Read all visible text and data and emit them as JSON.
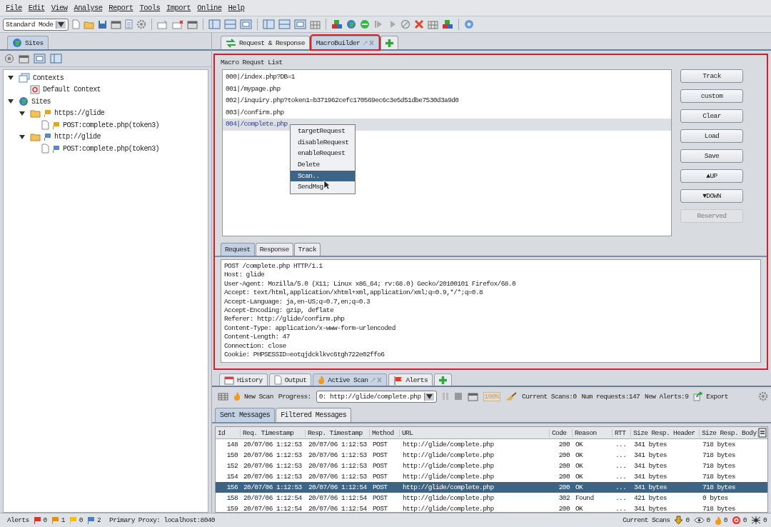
{
  "menu": [
    {
      "label": "File"
    },
    {
      "label": "Edit"
    },
    {
      "label": "View"
    },
    {
      "label": "Analyse"
    },
    {
      "label": "Report"
    },
    {
      "label": "Tools"
    },
    {
      "label": "Import"
    },
    {
      "label": "Online"
    },
    {
      "label": "Help"
    }
  ],
  "mode_select": {
    "value": "Standard Mode"
  },
  "left_tabs": [
    {
      "label": "Sites",
      "selected": true
    }
  ],
  "tree": [
    {
      "label": "Contexts",
      "kind": "contexts",
      "expanded": true,
      "children": [
        {
          "label": "Default Context",
          "kind": "context"
        }
      ]
    },
    {
      "label": "Sites",
      "kind": "globe",
      "expanded": true,
      "children": [
        {
          "label": "https://glide",
          "kind": "folder",
          "color": "#e8a317",
          "expanded": true,
          "children": [
            {
              "label": "POST:complete.php(token3)",
              "kind": "file",
              "color": "#e8a317"
            }
          ]
        },
        {
          "label": "http://glide",
          "kind": "folder",
          "color": "#5b87c5",
          "expanded": true,
          "children": [
            {
              "label": "POST:complete.php(token3)",
              "kind": "file",
              "color": "#5b87c5"
            }
          ]
        }
      ]
    }
  ],
  "work_tabs": [
    {
      "label": "Request & Response",
      "kind": "arrows",
      "selected": false,
      "annotated": false
    },
    {
      "label": "MacroBuilder",
      "kind": "plain",
      "selected": true,
      "annotated": true
    }
  ],
  "macro": {
    "title": "Macro Requst List",
    "annotated": true,
    "requests": [
      {
        "text": "000|/index.php?DB=1",
        "selected": false
      },
      {
        "text": "001|/mypage.php",
        "selected": false
      },
      {
        "text": "002|/inquiry.php?token1=b371962cefc170569ec6c3e5d51dbe7530d3a9d0",
        "selected": false
      },
      {
        "text": "003|/confirm.php",
        "selected": false
      },
      {
        "text": "004|/complete.php",
        "selected": true
      }
    ],
    "buttons": [
      {
        "label": "Track",
        "disabled": false
      },
      {
        "label": "custom",
        "disabled": false
      },
      {
        "label": "Clear",
        "disabled": false
      },
      {
        "label": "Load",
        "disabled": false
      },
      {
        "label": "Save",
        "disabled": false
      },
      {
        "label": "▲UP",
        "disabled": false
      },
      {
        "label": "▼DOWN",
        "disabled": false
      },
      {
        "label": "Reserved",
        "disabled": true
      }
    ],
    "context_menu": [
      {
        "label": "targetRequest",
        "selected": false
      },
      {
        "label": "disableRequest",
        "selected": false
      },
      {
        "label": "enableRequest",
        "selected": false
      },
      {
        "label": "Delete",
        "selected": false
      },
      {
        "label": "Scan..",
        "selected": true
      },
      {
        "label": "SendMsg",
        "selected": false
      }
    ],
    "detail_tabs": [
      {
        "label": "Request",
        "selected": true
      },
      {
        "label": "Response",
        "selected": false
      },
      {
        "label": "Track",
        "selected": false
      }
    ],
    "request_lines": [
      "POST /complete.php HTTP/1.1",
      "Host: glide",
      "User-Agent: Mozilla/5.0 (X11; Linux x86_64; rv:68.0) Gecko/20100101 Firefox/68.0",
      "Accept: text/html,application/xhtml+xml,application/xml;q=0.9,*/*;q=0.8",
      "Accept-Language: ja,en-US;q=0.7,en;q=0.3",
      "Accept-Encoding: gzip, deflate",
      "Referer: http://glide/confirm.php",
      "Content-Type: application/x-www-form-urlencoded",
      "Content-Length: 47",
      "Connection: close",
      "Cookie: PHPSESSID=eotqjdcklkvc6tgh722e02ffo6"
    ]
  },
  "bottom_tabs": [
    {
      "label": "History",
      "kind": "calendar",
      "selected": false
    },
    {
      "label": "Output",
      "kind": "page",
      "selected": false
    },
    {
      "label": "Active Scan",
      "kind": "flame",
      "selected": true
    },
    {
      "label": "Alerts",
      "kind": "flag",
      "selected": false
    }
  ],
  "scan_bar": {
    "new_scan": "New Scan",
    "progress_label": "Progress:",
    "progress_value": "0: http://glide/complete.php",
    "percent": "100%",
    "current_scans": "Current Scans:0",
    "num_requests": "Num requests:147",
    "new_alerts": "New Alerts:9",
    "export": "Export"
  },
  "message_tabs": [
    {
      "label": "Sent Messages",
      "selected": true
    },
    {
      "label": "Filtered Messages",
      "selected": false
    }
  ],
  "table": {
    "columns": [
      "Id",
      "Req. Timestamp",
      "Resp. Timestamp",
      "Method",
      "URL",
      "Code",
      "Reason",
      "RTT",
      "Size Resp. Header",
      "Size Resp. Body"
    ],
    "rows": [
      {
        "cells": [
          "148",
          "20/07/06 1:12:53",
          "20/07/06 1:12:53",
          "POST",
          "http://glide/complete.php",
          "200",
          "OK",
          "...",
          "341 bytes",
          "718 bytes"
        ],
        "selected": false
      },
      {
        "cells": [
          "150",
          "20/07/06 1:12:53",
          "20/07/06 1:12:53",
          "POST",
          "http://glide/complete.php",
          "200",
          "OK",
          "...",
          "341 bytes",
          "718 bytes"
        ],
        "selected": false
      },
      {
        "cells": [
          "152",
          "20/07/06 1:12:53",
          "20/07/06 1:12:53",
          "POST",
          "http://glide/complete.php",
          "200",
          "OK",
          "...",
          "341 bytes",
          "718 bytes"
        ],
        "selected": false
      },
      {
        "cells": [
          "154",
          "20/07/06 1:12:53",
          "20/07/06 1:12:53",
          "POST",
          "http://glide/complete.php",
          "200",
          "OK",
          "...",
          "341 bytes",
          "718 bytes"
        ],
        "selected": false
      },
      {
        "cells": [
          "156",
          "20/07/06 1:12:53",
          "20/07/06 1:12:54",
          "POST",
          "http://glide/complete.php",
          "200",
          "OK",
          "...",
          "341 bytes",
          "718 bytes"
        ],
        "selected": true
      },
      {
        "cells": [
          "158",
          "20/07/06 1:12:54",
          "20/07/06 1:12:54",
          "POST",
          "http://glide/complete.php",
          "302",
          "Found",
          "...",
          "421 bytes",
          "0 bytes"
        ],
        "selected": false
      },
      {
        "cells": [
          "159",
          "20/07/06 1:12:54",
          "20/07/06 1:12:54",
          "POST",
          "http://glide/complete.php",
          "200",
          "OK",
          "...",
          "341 bytes",
          "718 bytes"
        ],
        "selected": false
      }
    ]
  },
  "status_bar": {
    "alerts_label": "Alerts",
    "alert_counts": [
      {
        "color": "#d9342b",
        "count": "0"
      },
      {
        "color": "#f08c00",
        "count": "1"
      },
      {
        "color": "#f2c200",
        "count": "0"
      },
      {
        "color": "#4a7fc1",
        "count": "2"
      }
    ],
    "proxy": "Primary Proxy: localhost:8040",
    "current_scans": "Current Scans",
    "scan_counts": [
      {
        "kind": "spider",
        "count": "0"
      },
      {
        "kind": "eye",
        "count": "0"
      },
      {
        "kind": "flame",
        "count": "0"
      },
      {
        "kind": "target",
        "count": "0"
      },
      {
        "kind": "bug",
        "count": "0"
      }
    ]
  }
}
